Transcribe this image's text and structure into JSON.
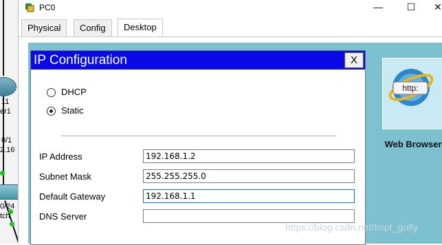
{
  "window": {
    "title": "PC0",
    "controls": {
      "minimize": "—",
      "maximize": "☐",
      "close": "✕"
    }
  },
  "tabs": [
    {
      "label": "Physical",
      "active": false
    },
    {
      "label": "Config",
      "active": false
    },
    {
      "label": "Desktop",
      "active": true
    }
  ],
  "topology_labels": {
    "router_num": "11",
    "router_name": "er1",
    "port_a": "0/1",
    "ip_frag": "2.16",
    "port_b": "0/24",
    "switch_name": "tch"
  },
  "desktop_apps": [
    {
      "label": "Web Browser",
      "icon": "web-browser-icon",
      "icon_text": "http:"
    }
  ],
  "dialog": {
    "title": "IP Configuration",
    "close_label": "X",
    "modes": [
      {
        "label": "DHCP",
        "checked": false
      },
      {
        "label": "Static",
        "checked": true
      }
    ],
    "fields": [
      {
        "label": "IP Address",
        "value": "192.168.1.2"
      },
      {
        "label": "Subnet Mask",
        "value": "255.255.255.0"
      },
      {
        "label": "Default Gateway",
        "value": "192.168.1.1",
        "focused": true
      },
      {
        "label": "DNS Server",
        "value": ""
      }
    ]
  },
  "watermark": "https://blog.csdn.net/lmpt_gofly",
  "colors": {
    "dialog_title_bg": "#0a0ae6",
    "desktop_bg": "#7dc0d0",
    "link_green": "#1ec31e"
  }
}
